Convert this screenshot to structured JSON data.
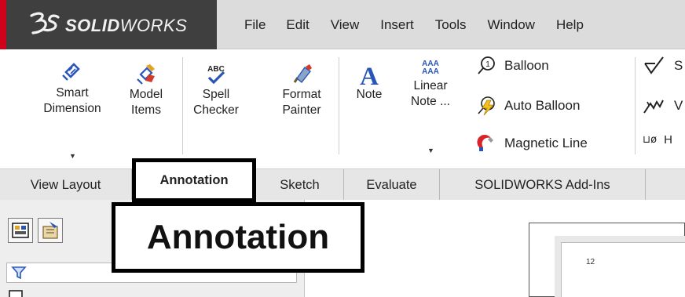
{
  "app": {
    "logo_text_bold": "SOLID",
    "logo_text_light": "WORKS",
    "logo_prefix": "3S",
    "brand_color": "#d0021b"
  },
  "menu": [
    "File",
    "Edit",
    "View",
    "Insert",
    "Tools",
    "Window",
    "Help"
  ],
  "ribbon": {
    "smart_dimension": [
      "Smart",
      "Dimension"
    ],
    "model_items": [
      "Model",
      "Items"
    ],
    "spell_checker": [
      "Spell",
      "Checker"
    ],
    "spell_icon_text": "ABC",
    "format_painter": [
      "Format",
      "Painter"
    ],
    "note": "Note",
    "note_icon_text": "A",
    "linear_note": [
      "Linear",
      "Note ..."
    ],
    "linear_icon_text": [
      "AAA",
      "AAA"
    ],
    "balloon": "Balloon",
    "balloon_icon_text": "1",
    "auto_balloon": "Auto Balloon",
    "magnetic_line": "Magnetic Line",
    "surface_finish_partial": "S",
    "weld_partial": "V",
    "hole_partial": "H",
    "hole_icon_text": "⊔ø"
  },
  "tabs": [
    "View Layout",
    "Annotation",
    "Sketch",
    "Evaluate",
    "SOLIDWORKS Add-Ins"
  ],
  "active_tab": "Annotation",
  "callout": {
    "text": "Annotation"
  },
  "canvas": {
    "sheet_label": "12"
  },
  "icons": [
    "3ds-logo-icon",
    "smart-dimension-icon",
    "model-items-icon",
    "spell-checker-icon",
    "format-painter-icon",
    "note-icon",
    "linear-note-icon",
    "balloon-icon",
    "auto-balloon-icon",
    "magnetic-line-icon",
    "surface-finish-icon",
    "weld-symbol-icon",
    "hole-callout-icon",
    "feature-manager-icon",
    "property-manager-icon",
    "filter-icon"
  ]
}
